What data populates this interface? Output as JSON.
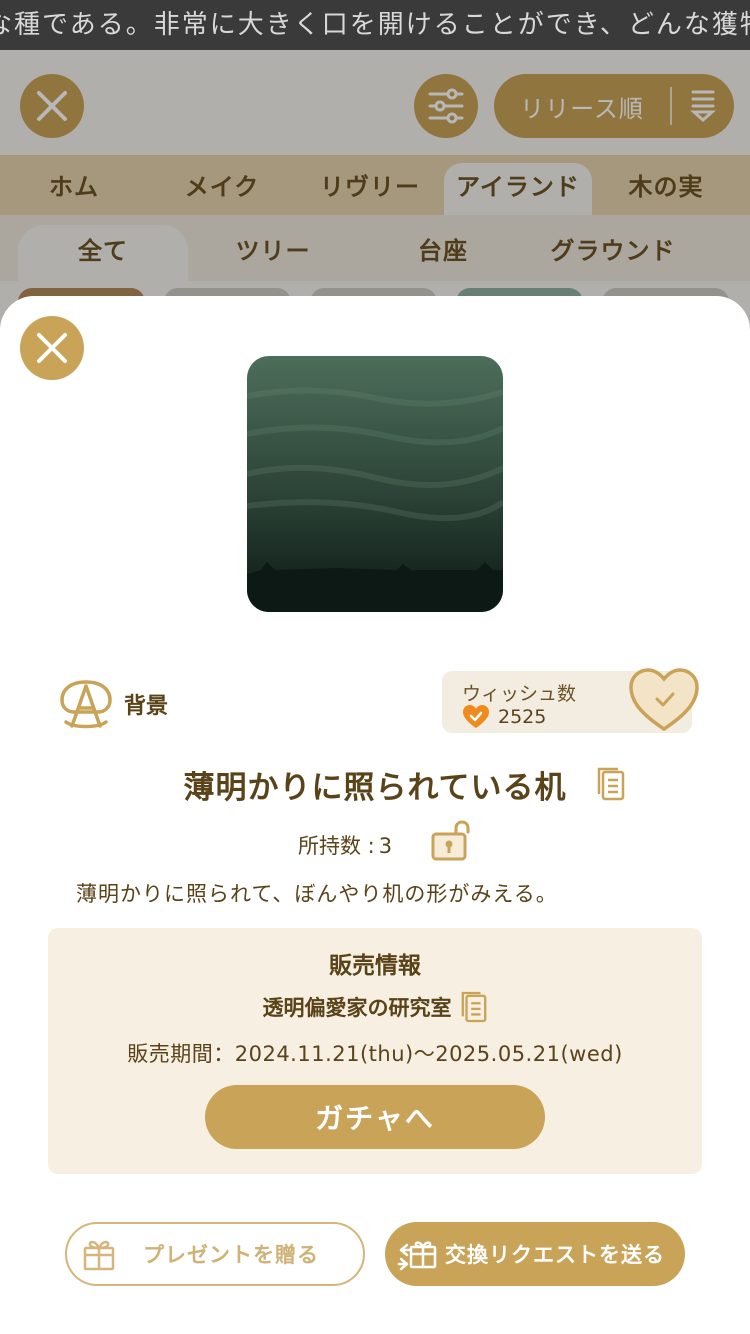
{
  "marquee": {
    "text": "な種である。非常に大きく口を開けることができ、どんな獲物も丸呑み"
  },
  "header": {
    "sort_label": "リリース順"
  },
  "category_tabs": [
    {
      "label": "ホム"
    },
    {
      "label": "メイク"
    },
    {
      "label": "リヴリー"
    },
    {
      "label": "アイランド",
      "active": true
    },
    {
      "label": "木の実"
    }
  ],
  "sub_tabs": [
    {
      "label": "全て",
      "active": true
    },
    {
      "label": "ツリー"
    },
    {
      "label": "台座"
    },
    {
      "label": "グラウンド"
    }
  ],
  "item": {
    "type_label": "背景",
    "wish_title": "ウィッシュ数",
    "wish_count": "2525",
    "name": "薄明かりに照られている机",
    "owned_label": "所持数 :",
    "owned_count": "3",
    "description": "薄明かりに照られて、ぼんやり机の形がみえる。"
  },
  "sale": {
    "title": "販売情報",
    "shop": "透明偏愛家の研究室",
    "period": "販売期間：2024.11.21(thu)〜2025.05.21(wed)",
    "gacha_button": "ガチャへ"
  },
  "actions": {
    "present_label": "プレゼントを贈る",
    "trade_label": "交換リクエストを送る"
  },
  "colors": {
    "accent": "#c9a357",
    "text": "#5a4318",
    "wish_heart": "#f08a1d"
  }
}
